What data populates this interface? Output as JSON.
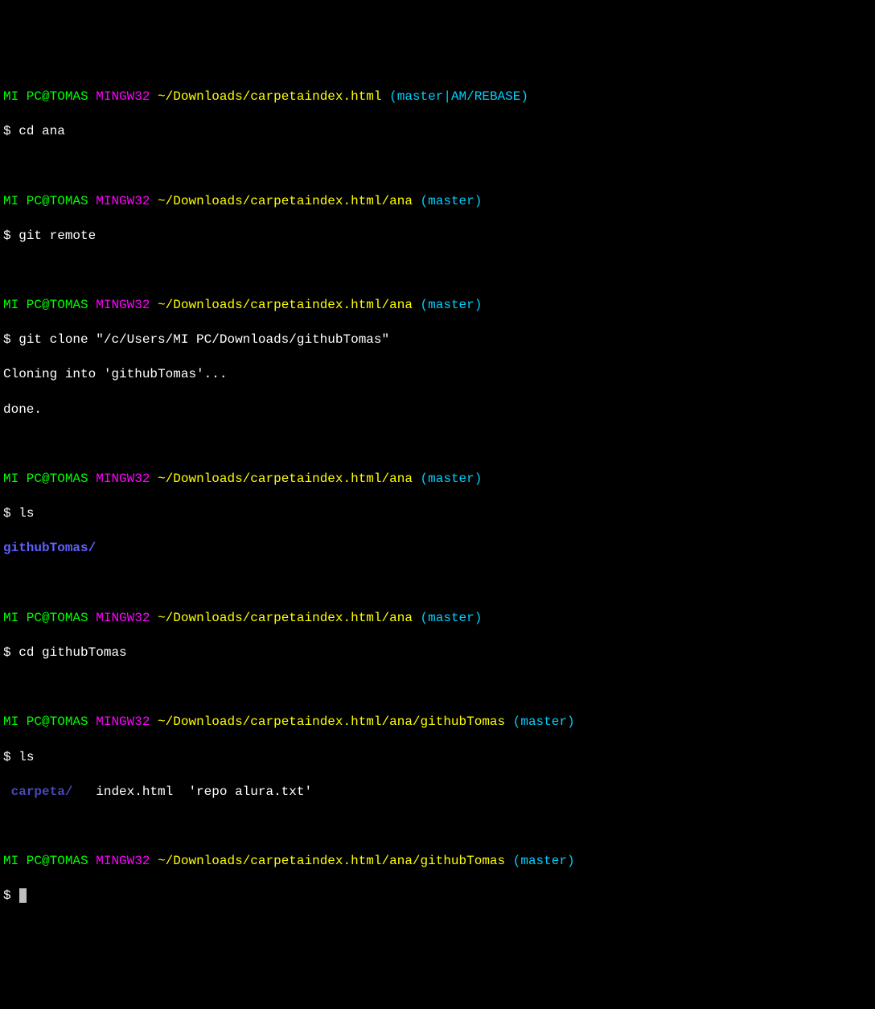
{
  "prompts": [
    {
      "user": "MI PC@TOMAS",
      "host": "MINGW32",
      "path": "~/Downloads/carpetaindex.html",
      "branch": "(master|AM/REBASE)"
    },
    {
      "user": "MI PC@TOMAS",
      "host": "MINGW32",
      "path": "~/Downloads/carpetaindex.html/ana",
      "branch": "(master)"
    },
    {
      "user": "MI PC@TOMAS",
      "host": "MINGW32",
      "path": "~/Downloads/carpetaindex.html/ana",
      "branch": "(master)"
    },
    {
      "user": "MI PC@TOMAS",
      "host": "MINGW32",
      "path": "~/Downloads/carpetaindex.html/ana",
      "branch": "(master)"
    },
    {
      "user": "MI PC@TOMAS",
      "host": "MINGW32",
      "path": "~/Downloads/carpetaindex.html/ana",
      "branch": "(master)"
    },
    {
      "user": "MI PC@TOMAS",
      "host": "MINGW32",
      "path": "~/Downloads/carpetaindex.html/ana/githubTomas",
      "branch": "(master)"
    },
    {
      "user": "MI PC@TOMAS",
      "host": "MINGW32",
      "path": "~/Downloads/carpetaindex.html/ana/githubTomas",
      "branch": "(master)"
    }
  ],
  "dollar": "$",
  "commands": {
    "cd_ana": "cd ana",
    "git_remote": "git remote",
    "git_clone": "git clone \"/c/Users/MI PC/Downloads/githubTomas\"",
    "ls1": "ls",
    "cd_github": "cd githubTomas",
    "ls2": "ls",
    "empty": ""
  },
  "outputs": {
    "clone_line1": "Cloning into 'githubTomas'...",
    "clone_line2": "done.",
    "ls1_dir": "githubTomas/",
    "ls2_space": " ",
    "ls2_dir": "carpeta/",
    "ls2_gap1": "   ",
    "ls2_file1": "index.html",
    "ls2_gap2": "  ",
    "ls2_file2": "'repo alura.txt'"
  }
}
